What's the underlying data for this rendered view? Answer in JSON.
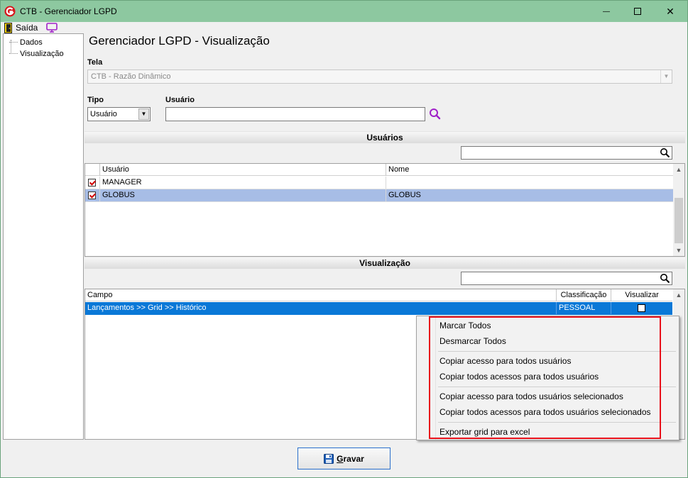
{
  "window": {
    "title": "CTB - Gerenciador LGPD",
    "minimize_glyph": "—",
    "maximize_glyph": "☐",
    "close_glyph": "✕"
  },
  "menu": {
    "exit_label": "Saída",
    "exit_icon": "door-exit-icon",
    "monitor_icon": "monitor-icon"
  },
  "tree": {
    "items": [
      "Dados",
      "Visualização"
    ]
  },
  "main": {
    "title": "Gerenciador LGPD - Visualização",
    "tela_label": "Tela",
    "tela_value": "CTB - Razão Dinâmico",
    "tipo_label": "Tipo",
    "tipo_value": "Usuário",
    "usuario_label": "Usuário",
    "usuario_value": ""
  },
  "users_section": {
    "title": "Usuários",
    "filter_value": "",
    "columns": [
      "Usuário",
      "Nome"
    ],
    "rows": [
      {
        "checked": true,
        "usuario": "MANAGER",
        "nome": ""
      },
      {
        "checked": true,
        "usuario": "GLOBUS",
        "nome": "GLOBUS"
      }
    ]
  },
  "view_section": {
    "title": "Visualização",
    "filter_value": "",
    "columns": [
      "Campo",
      "Classificação",
      "Visualizar"
    ],
    "rows": [
      {
        "campo": "Lançamentos >> Grid >> Histórico",
        "classificacao": "PESSOAL",
        "visualizar": false
      }
    ]
  },
  "context_menu": {
    "items": [
      "Marcar Todos",
      "Desmarcar Todos",
      "Copiar acesso para todos usuários",
      "Copiar todos acessos para todos usuários",
      "Copiar acesso para todos usuários selecionados",
      "Copiar todos acessos para todos usuários selecionados",
      "Exportar grid para excel"
    ]
  },
  "footer": {
    "save_prefix": "G",
    "save_rest": "ravar"
  },
  "colors": {
    "titlebar": "#8dc8a0",
    "selected_row": "#a7bde6",
    "selected_row_active": "#0a78d7",
    "highlight": "#e8101a",
    "accent_purple": "#a020c8"
  }
}
